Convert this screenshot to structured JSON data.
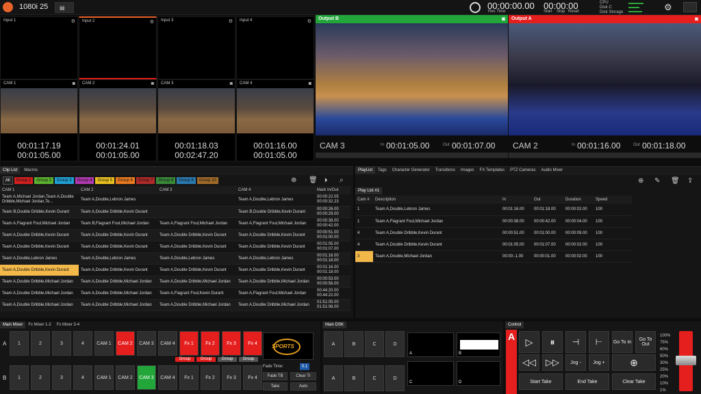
{
  "top": {
    "format": "1080i 25",
    "rec_time": "00:00:00.00",
    "rec_label": "Rec Time",
    "timer": "00:00:00",
    "start": "Start",
    "stop": "Stop",
    "reset": "Reset",
    "cpu": "CPU",
    "disk_c": "Disk C",
    "disk_storage": "Disk Storage"
  },
  "inputs": [
    "Input 1",
    "Input 2",
    "Input 3",
    "Input 4"
  ],
  "cams": [
    {
      "label": "CAM 1",
      "tc1": "00:01:17.19",
      "tc2": "00:01:05.00"
    },
    {
      "label": "CAM 2",
      "tc1": "00:01:24.01",
      "tc2": "00:01:05.00"
    },
    {
      "label": "CAM 3",
      "tc1": "00:01:18.03",
      "tc2": "00:02:47.20"
    },
    {
      "label": "CAM 4",
      "tc1": "00:01:16.00",
      "tc2": "00:01:05.00"
    }
  ],
  "outputs": {
    "b": {
      "label": "Output B",
      "cam": "CAM 3",
      "in_label": "In",
      "in": "00:01:05.00",
      "out_label": "Out",
      "out": "00:01:07.00"
    },
    "a": {
      "label": "Output A",
      "cam": "CAM 2",
      "in_label": "In",
      "in": "00:01:16.00",
      "out_label": "Out",
      "out": "00:01:18.00"
    }
  },
  "cliplist": {
    "tabs": [
      "Clip List",
      "Macros"
    ],
    "groups": [
      {
        "label": "All",
        "color": "#ffffff"
      },
      {
        "label": "Group 1",
        "color": "#d21f1f"
      },
      {
        "label": "Group 2",
        "color": "#5bb030"
      },
      {
        "label": "Group 3",
        "color": "#1f9fd2"
      },
      {
        "label": "Group 4",
        "color": "#b03ab0"
      },
      {
        "label": "Group 5",
        "color": "#e8c020"
      },
      {
        "label": "Group 6",
        "color": "#e87a20"
      },
      {
        "label": "Group 7",
        "color": "#b02a2a"
      },
      {
        "label": "Group 8",
        "color": "#3a8a3a"
      },
      {
        "label": "Group 9",
        "color": "#2a7ab0"
      },
      {
        "label": "Group 10",
        "color": "#a06a2a"
      }
    ],
    "headers": [
      "CAM 1",
      "CAM 2",
      "CAM 3",
      "CAM 4",
      "Mark In/Out"
    ],
    "rows": [
      [
        "Team A,Michael Jordan,Team A,Double Dribble,Michael Jordan,Te...",
        "Team A,Double,Lebron James",
        "",
        "Team A,Double,Lebron James",
        "00:00:22.05\n00:00:32.23"
      ],
      [
        "Team B,Double Dribble,Kevin Durant",
        "Team A,Double Dribble,Kevin Durant",
        "",
        "Team B,Double Dribble,Kevin Durant",
        "00:00:26.00\n00:00:29.00"
      ],
      [
        "Team A,Flagrant Foul,Michael Jordan",
        "Team B,Flagrant Foul,Michael Jordan",
        "Team A,Flagrant Foul,Michael Jordan",
        "Team A,Flagrant Foul,Michael Jordan",
        "00:00:38.00\n00:00:42.00"
      ],
      [
        "Team A,Double Dribble,Kevin Durant",
        "Team A,Double Dribble,Kevin Durant",
        "Team A,Double Dribble,Kevin Durant",
        "Team A,Double Dribble,Kevin Durant",
        "00:00:51.00\n00:01:00.00"
      ],
      [
        "Team A,Double Dribble,Kevin Durant",
        "Team A,Double Dribble,Kevin Durant",
        "Team A,Double Dribble,Kevin Durant",
        "Team A,Double Dribble,Kevin Durant",
        "00:01:05.00\n00:01:07.00"
      ],
      [
        "Team A,Double,Lebron James",
        "Team A,Double,Lebron James",
        "Team A,Double,Lebron James",
        "Team A,Double,Lebron James",
        "00:01:16.00\n00:01:18.00"
      ],
      [
        "Team A,Double Dribble,Kevin Durant",
        "Team A,Double Dribble,Kevin Durant",
        "Team A,Double Dribble,Kevin Durant",
        "Team A,Double Dribble,Kevin Durant",
        "00:01:16.00\n00:01:18.00"
      ],
      [
        "Team A,Double Dribble,Michael Jordan",
        "Team A,Double Dribble,Michael Jordan",
        "Team A,Double Dribble,Michael Jordan",
        "Team A,Double Dribble,Michael Jordan",
        "00:00:53.00\n00:00:56.00"
      ],
      [
        "Team A,Double Dribble,Michael Jordan",
        "Team A,Double Dribble,Michael Jordan",
        "Team A,Flagrant Foul,Kevin Durant",
        "Team A,Flagrant Foul,Michael Jordan",
        "00:44:20.00\n00:44:22.00"
      ],
      [
        "Team A,Double Dribble,Michael Jordan",
        "Team A,Double Dribble,Michael Jordan",
        "Team A,Double Dribble,Michael Jordan",
        "Team A,Double Dribble,Michael Jordan",
        "01:51:05.00\n01:51:06.00"
      ]
    ],
    "selected_row": 6
  },
  "playlist": {
    "tabs": [
      "PlayList",
      "Tags",
      "Character Generator",
      "Transitions",
      "Images",
      "FX Templates",
      "PTZ Cameras",
      "Audio Mixer"
    ],
    "subtab": "Play List #1",
    "headers": [
      "Cam #",
      "Description",
      "In",
      "Out",
      "Duration",
      "Speed"
    ],
    "rows": [
      [
        "1",
        "Team A,Double,Lebron James",
        "00:01:16.00",
        "00:01:18.00",
        "00:00:02.00",
        "100"
      ],
      [
        "1",
        "Team A,Flagrant Foul,Michael Jordan",
        "00:00:38.00",
        "00:00:42.00",
        "00:00:04.00",
        "100"
      ],
      [
        "4",
        "Team A,Double Dribble,Kevin Durant",
        "00:00:51.00",
        "00:01:00.00",
        "00:00:09.00",
        "100"
      ],
      [
        "4",
        "Team A,Double Dribble,Kevin Durant",
        "00:01:05.00",
        "00:01:07.00",
        "00:00:02.00",
        "100"
      ],
      [
        "3",
        "Team A,Double,Michael Jordan",
        "00:00:-1.00",
        "00:00:01.00",
        "00:00:02.00",
        "100"
      ]
    ]
  },
  "mixer": {
    "tabs": [
      "Main Mixer",
      "Fx Mixer 1-2",
      "Fx Mixer 3-4"
    ],
    "row_a_label": "A",
    "row_b_label": "B",
    "row_a": [
      "1",
      "2",
      "3",
      "4",
      "CAM 1",
      "CAM 2",
      "CAM 3",
      "CAM 4",
      "Fx 1",
      "Fx 2",
      "Fx 3",
      "Fx 4"
    ],
    "row_b": [
      "1",
      "2",
      "3",
      "4",
      "CAM 1",
      "CAM 2",
      "CAM 3",
      "CAM 4",
      "Fx 1",
      "Fx 2",
      "Fx 3",
      "Fx 4"
    ],
    "group_label": "Group",
    "fade_time_label": "Fade Time:",
    "fade_time": "0.1",
    "fade_tb": "Fade TB",
    "clear_tr": "Clear Tr",
    "take": "Take",
    "auto": "Auto",
    "logo_text": "SPORTS"
  },
  "dsk": {
    "tab": "Main DSK",
    "row1": [
      "A",
      "B",
      "C",
      "D"
    ],
    "row2": [
      "A",
      "B",
      "C",
      "D"
    ],
    "thumb_labels": [
      "A",
      "B",
      "C",
      "D"
    ]
  },
  "control": {
    "tab": "Control",
    "big": "A",
    "go_to_in": "Go To In",
    "go_to_out": "Go To Out",
    "jog_minus": "Jog -",
    "jog_plus": "Jog +",
    "start_take": "Start Take",
    "end_take": "End Take",
    "clear_take": "Clear Take",
    "speed_labels": [
      "100%",
      "75%",
      "60%",
      "50%",
      "30%",
      "25%",
      "20%",
      "10%",
      "1%"
    ]
  }
}
